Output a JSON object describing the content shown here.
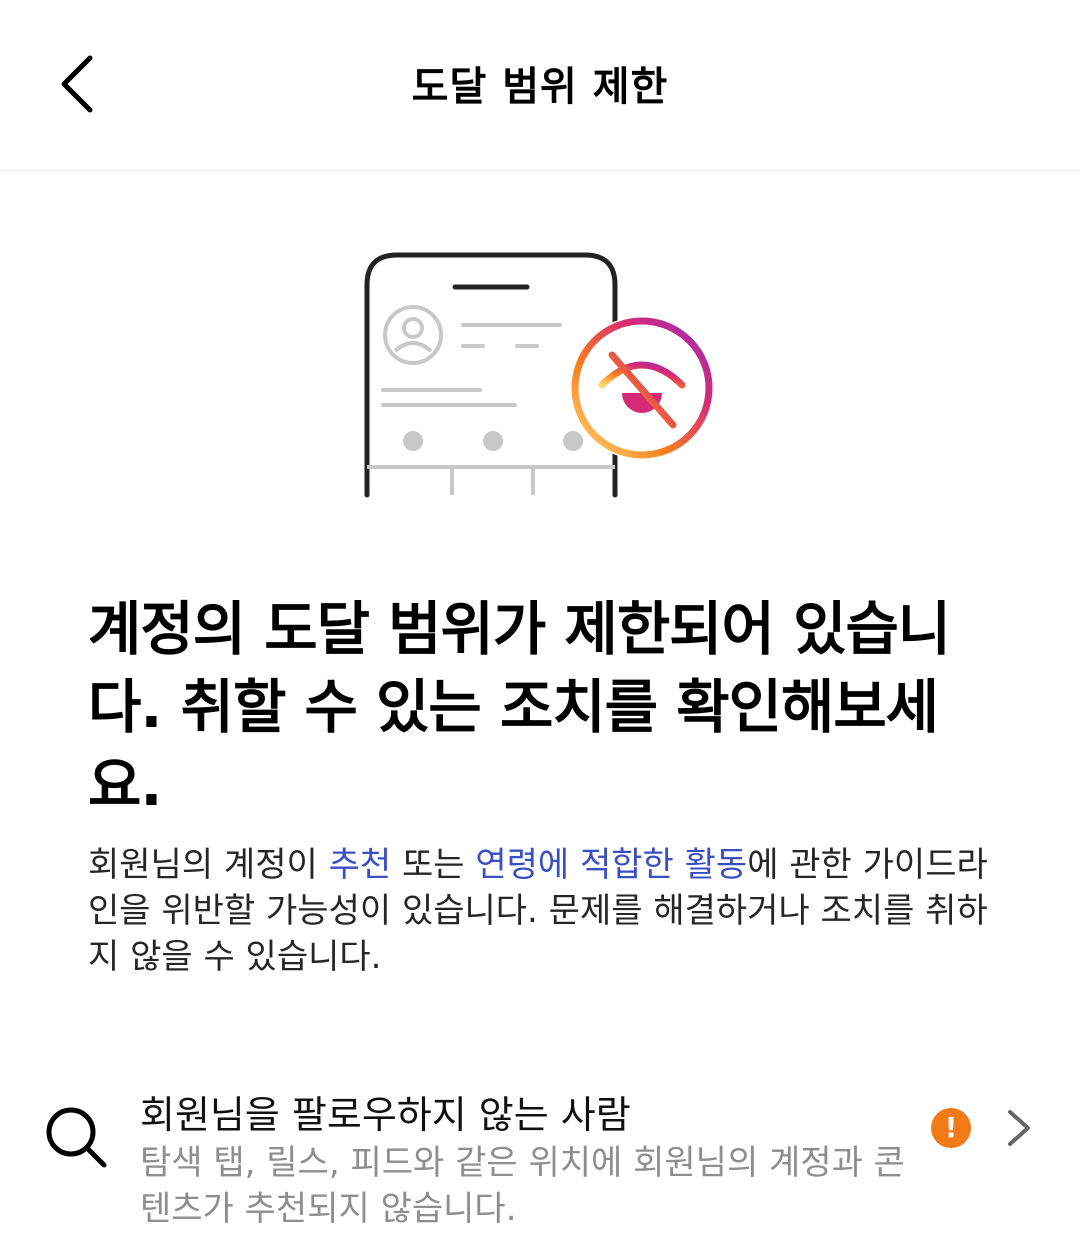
{
  "header": {
    "title": "도달 범위 제한",
    "back_icon": "chevron-left-icon"
  },
  "illustration": {
    "icon": "eye-slash-icon",
    "accent_colors": [
      "#feda75",
      "#fa7e1e",
      "#d62976",
      "#962fbf"
    ],
    "warning_color": "#d62976"
  },
  "main": {
    "headline": "계정의 도달 범위가 제한되어 있습니다. 취할 수 있는 조치를 확인해보세요.",
    "desc_prefix": "회원님의 계정이 ",
    "link_recommend": "추천",
    "desc_mid": " 또는 ",
    "link_age": "연령에 적합한 활동",
    "desc_suffix": "에 관한 가이드라인을 위반할 가능성이 있습니다. 문제를 해결하거나 조치를 취하지 않을 수 있습니다."
  },
  "list": {
    "items": [
      {
        "icon": "search-icon",
        "title": "회원님을 팔로우하지 않는 사람",
        "subtitle": "탐색 탭, 릴스, 피드와 같은 위치에 회원님의 계정과 콘텐츠가 추천되지 않습니다.",
        "badge": "!",
        "badge_color": "#f47a17"
      }
    ]
  }
}
